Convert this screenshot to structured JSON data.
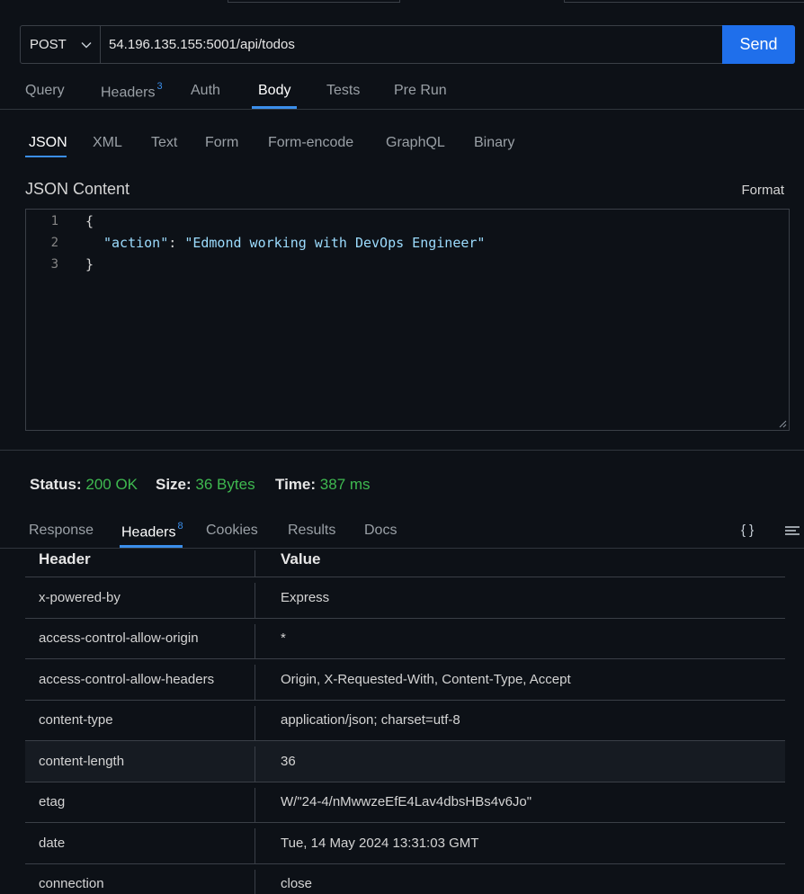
{
  "request": {
    "method": "POST",
    "url": "54.196.135.155:5001/api/todos",
    "send_label": "Send",
    "tabs": [
      {
        "label": "Query"
      },
      {
        "label": "Headers",
        "badge": "3"
      },
      {
        "label": "Auth"
      },
      {
        "label": "Body"
      },
      {
        "label": "Tests"
      },
      {
        "label": "Pre Run"
      }
    ],
    "active_tab": "Body"
  },
  "body": {
    "tabs": [
      "JSON",
      "XML",
      "Text",
      "Form",
      "Form-encode",
      "GraphQL",
      "Binary"
    ],
    "active_tab": "JSON",
    "content_label": "JSON Content",
    "format_label": "Format",
    "editor_lines": [
      {
        "num": "1",
        "text": "{"
      },
      {
        "num": "2",
        "key": "\"action\"",
        "colon": ": ",
        "value": "\"Edmond working with DevOps Engineer\""
      },
      {
        "num": "3",
        "text": "}"
      }
    ]
  },
  "status": {
    "status_label": "Status:",
    "status_value": "200 OK",
    "size_label": "Size:",
    "size_value": "36 Bytes",
    "time_label": "Time:",
    "time_value": "387 ms"
  },
  "response": {
    "tabs": [
      {
        "label": "Response"
      },
      {
        "label": "Headers",
        "badge": "8"
      },
      {
        "label": "Cookies"
      },
      {
        "label": "Results"
      },
      {
        "label": "Docs"
      }
    ],
    "active_tab": "Headers",
    "braces_icon": "{ }",
    "table": {
      "col_header": "Header",
      "col_value": "Value",
      "rows": [
        {
          "header": "x-powered-by",
          "value": "Express"
        },
        {
          "header": "access-control-allow-origin",
          "value": "*"
        },
        {
          "header": "access-control-allow-headers",
          "value": "Origin, X-Requested-With, Content-Type, Accept"
        },
        {
          "header": "content-type",
          "value": "application/json; charset=utf-8"
        },
        {
          "header": "content-length",
          "value": "36"
        },
        {
          "header": "etag",
          "value": "W/\"24-4/nMwwzeEfE4Lav4dbsHBs4v6Jo\""
        },
        {
          "header": "date",
          "value": "Tue, 14 May 2024 13:31:03 GMT"
        },
        {
          "header": "connection",
          "value": "close"
        }
      ]
    }
  },
  "colors": {
    "accent": "#3b8eea",
    "send_button": "#1f6feb",
    "success": "#3fb950",
    "background": "#0d1117"
  }
}
